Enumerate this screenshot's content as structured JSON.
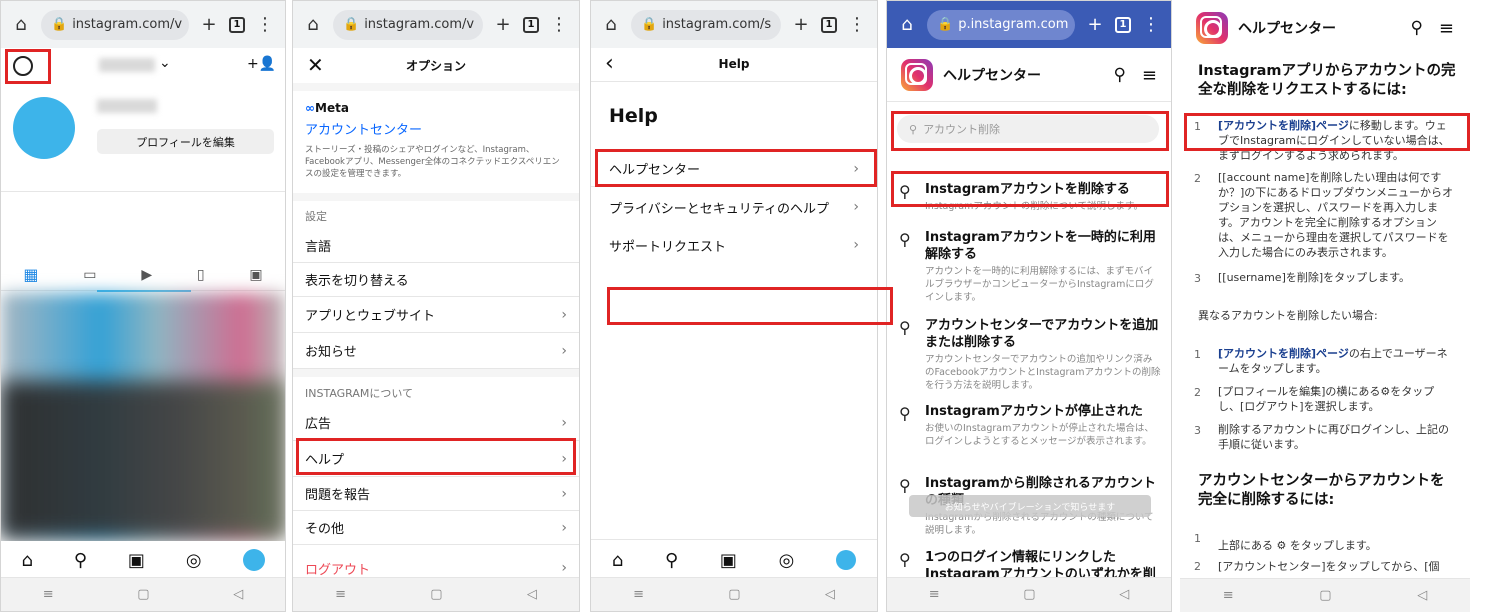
{
  "panel1": {
    "url": "instagram.com/v",
    "tab_count": "1",
    "edit_profile": "プロフィールを編集"
  },
  "panel2": {
    "url": "instagram.com/v",
    "tab_count": "1",
    "header_title": "オプション",
    "meta_label": "Meta",
    "account_center": "アカウントセンター",
    "account_center_desc": "ストーリーズ・投稿のシェアやログインなど、Instagram、Facebookアプリ、Messenger全体のコネクテッドエクスペリエンスの設定を管理できます。",
    "settings_label": "設定",
    "items": [
      "言語",
      "表示を切り替える",
      "アプリとウェブサイト",
      "お知らせ"
    ],
    "about_label": "INSTAGRAMについて",
    "about_items": [
      "広告",
      "ヘルプ",
      "問題を報告",
      "その他"
    ],
    "logout": "ログアウト"
  },
  "panel3": {
    "url": "instagram.com/s",
    "tab_count": "1",
    "header_title": "Help",
    "big_title": "Help",
    "items": [
      "ヘルプセンター",
      "プライバシーとセキュリティのヘルプ",
      "サポートリクエスト"
    ]
  },
  "panel4": {
    "url": "p.instagram.com",
    "tab_count": "1",
    "title": "ヘルプセンター",
    "search_value": "アカウント削除",
    "results": [
      {
        "title": "Instagramアカウントを削除する",
        "desc": "Instagramアカウントの削除について説明します。"
      },
      {
        "title": "Instagramアカウントを一時的に利用解除する",
        "desc": "アカウントを一時的に利用解除するには、まずモバイルブラウザーかコンピューターからInstagramにログインします。"
      },
      {
        "title": "アカウントセンターでアカウントを追加または削除する",
        "desc": "アカウントセンターでアカウントの追加やリンク済みのFacebookアカウントとInstagramアカウントの削除を行う方法を説明します。"
      },
      {
        "title": "Instagramアカウントが停止された",
        "desc": "お使いのInstagramアカウントが停止された場合は、ログインしようとするとメッセージが表示されます。"
      },
      {
        "title": "Instagramから削除されるアカウントの種類",
        "desc": "Instagramから削除されるアカウントの種類について説明します。"
      },
      {
        "title": "1つのログイン情報にリンクしたInstagramアカウントのいずれかを削",
        "desc": ""
      }
    ],
    "toast": "お知らせやバイブレーションで知らせます"
  },
  "panel5": {
    "title": "ヘルプセンター",
    "heading1": "Instagramアプリからアカウントの完全な削除をリクエストするには:",
    "steps1": [
      {
        "num": "1",
        "link": "[アカウントを削除]ページ",
        "text": "に移動します。ウェブでInstagramにログインしていない場合は、まずログインするよう求められます。"
      },
      {
        "num": "2",
        "link": "",
        "text": "[[account name]を削除したい理由は何ですか？]の下にあるドロップダウンメニューからオプションを選択し、パスワードを再入力します。アカウントを完全に削除するオプションは、メニューから理由を選択してパスワードを入力した場合にのみ表示されます。"
      },
      {
        "num": "3",
        "link": "",
        "text": "[[username]を削除]をタップします。"
      }
    ],
    "other_account": "異なるアカウントを削除したい場合:",
    "steps2": [
      {
        "num": "1",
        "link": "[アカウントを削除]ページ",
        "text": "の右上でユーザーネームをタップします。"
      },
      {
        "num": "2",
        "link": "",
        "text": "[プロフィールを編集]の横にある⚙をタップし、[ログアウト]を選択します。"
      },
      {
        "num": "3",
        "link": "",
        "text": "削除するアカウントに再びログインし、上記の手順に従います。"
      }
    ],
    "heading2": "アカウントセンターからアカウントを完全に削除するには:",
    "steps3": [
      {
        "num": "1",
        "text": "上部にある ⚙ をタップします。"
      },
      {
        "num": "2",
        "text": "[アカウントセンター]をタップしてから、[個"
      }
    ]
  }
}
